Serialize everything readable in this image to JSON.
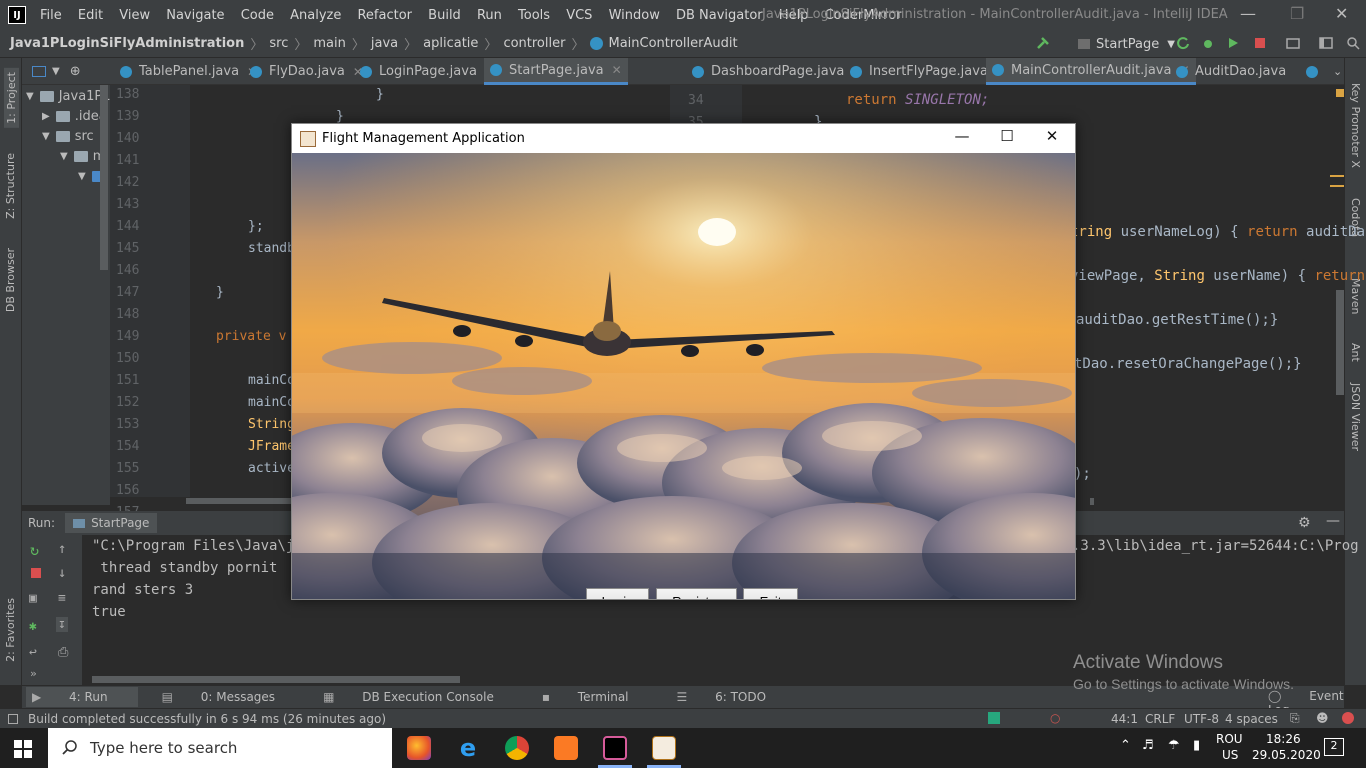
{
  "menubar": {
    "items": [
      "File",
      "Edit",
      "View",
      "Navigate",
      "Code",
      "Analyze",
      "Refactor",
      "Build",
      "Run",
      "Tools",
      "VCS",
      "Window",
      "DB Navigator",
      "Help",
      "CoderMirror"
    ],
    "window_title": "Java1PLoginSiFlyAdministration - MainControllerAudit.java - IntelliJ IDEA"
  },
  "breadcrumbs": [
    "Java1PLoginSiFlyAdministration",
    "src",
    "main",
    "java",
    "aplicatie",
    "controller",
    "MainControllerAudit"
  ],
  "run_config": "StartPage",
  "tabs_left": [
    "TablePanel.java",
    "FlyDao.java",
    "LoginPage.java",
    "StartPage.java"
  ],
  "tabs_right": [
    "DashboardPage.java",
    "InsertFlyPage.java",
    "MainControllerAudit.java",
    "AuditDao.java"
  ],
  "project_tree": {
    "root": "Java1PLo",
    "idea": ".idea",
    "src": "src",
    "main": "m"
  },
  "editor_left": {
    "line_numbers": [
      "138",
      "139",
      "140",
      "141",
      "142",
      "143",
      "144",
      "145",
      "146",
      "147",
      "148",
      "149",
      "150",
      "151",
      "152",
      "153",
      "154",
      "155",
      "156",
      "157"
    ],
    "code": {
      "l138": "}",
      "l139": "}",
      "l144": "};",
      "l145": "standb",
      "l148": "}",
      "l150_kw": "private v",
      "l152": "mainCo",
      "l153": "mainCo",
      "l154": "String",
      "l155": "JFrame",
      "l156": "active"
    }
  },
  "editor_right": {
    "line_numbers": [
      "34",
      "35"
    ],
    "code": {
      "return_kw": "return",
      "singleton": "SINGLETON;",
      "brace": "}",
      "r1_pre": "tring ",
      "r1_param": "userNameLog",
      "r1_mid": ") { ",
      "r1_ret": "return",
      "r1_call": " auditDa",
      "r2_pre": "viewPage, ",
      "r2_type": "String",
      "r2_param": " userName",
      "r2_mid": ") { ",
      "r2_ret": "return",
      "r3": "auditDao.getRestTime();}",
      "r4": "tDao.resetOraChangePage();}",
      "r5": ");"
    }
  },
  "run_panel": {
    "label": "Run:",
    "config": "StartPage",
    "output": [
      "\"C:\\Program Files\\Java\\jd",
      " thread standby pornit",
      "rand sters 3",
      "true"
    ],
    "output_right": ".3.3\\lib\\idea_rt.jar=52644:C:\\Prog"
  },
  "bottom_tools": [
    "4: Run",
    "0: Messages",
    "DB Execution Console",
    "Terminal",
    "6: TODO"
  ],
  "event_log": "Event Log",
  "status": {
    "message": "Build completed successfully in 6 s 94 ms (26 minutes ago)",
    "position": "44:1",
    "line_sep": "CRLF",
    "encoding": "UTF-8",
    "indent": "4 spaces"
  },
  "left_strip": [
    "1: Project",
    "Z: Structure",
    "DB Browser",
    "2: Favorites"
  ],
  "right_strip": [
    "Key Promoter X",
    "Codota",
    "Maven",
    "Ant",
    "JSON Viewer"
  ],
  "watermark": {
    "line1": "Activate Windows",
    "line2": "Go to Settings to activate Windows."
  },
  "taskbar": {
    "search_placeholder": "Type here to search",
    "lang1": "ROU",
    "lang2": "US",
    "time": "18:26",
    "date": "29.05.2020",
    "notif_count": "2"
  },
  "dialog": {
    "title": "Flight Management Application",
    "buttons": [
      "Login",
      "Register",
      "Exit"
    ]
  },
  "colors": {
    "ide_bg": "#2b2b2b",
    "panel": "#3c3f41",
    "accent": "#4a88c7",
    "keyword": "#cc7832",
    "constant": "#9876aa"
  }
}
